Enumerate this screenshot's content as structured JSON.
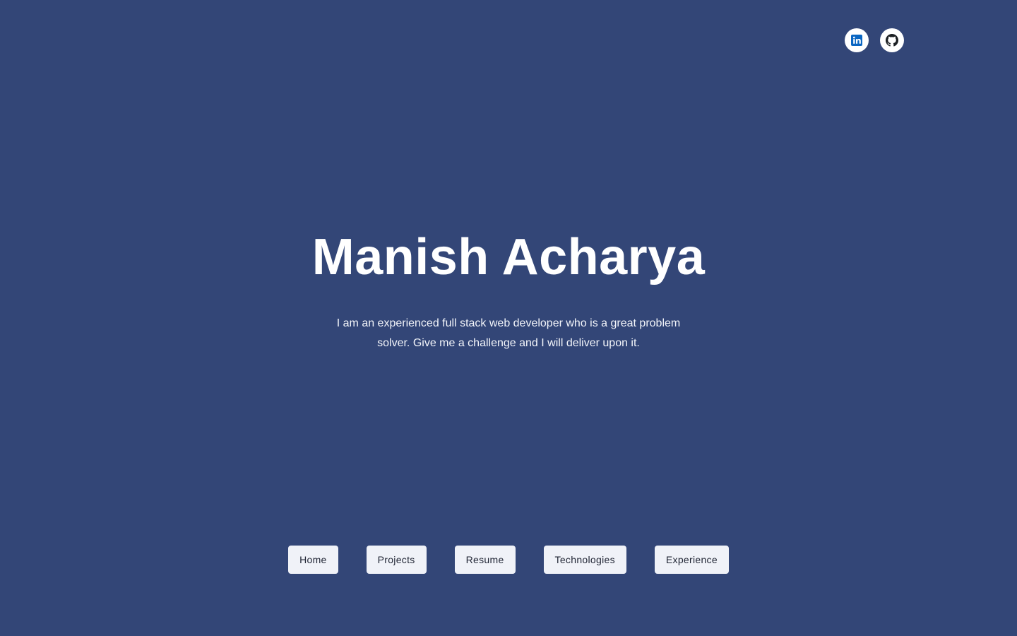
{
  "header": {
    "social": [
      {
        "name": "linkedin-icon",
        "color": "#0a66c2"
      },
      {
        "name": "github-icon",
        "color": "#1b1f23"
      }
    ]
  },
  "hero": {
    "name": "Manish Acharya",
    "tagline": "I am an experienced full stack web developer who is a great problem solver. Give me a challenge and I will deliver upon it."
  },
  "nav": {
    "items": [
      {
        "label": "Home"
      },
      {
        "label": "Projects"
      },
      {
        "label": "Resume"
      },
      {
        "label": "Technologies"
      },
      {
        "label": "Experience"
      }
    ]
  },
  "colors": {
    "background": "#334677",
    "button_bg": "#f0f2f8",
    "button_text": "#1f2433"
  }
}
